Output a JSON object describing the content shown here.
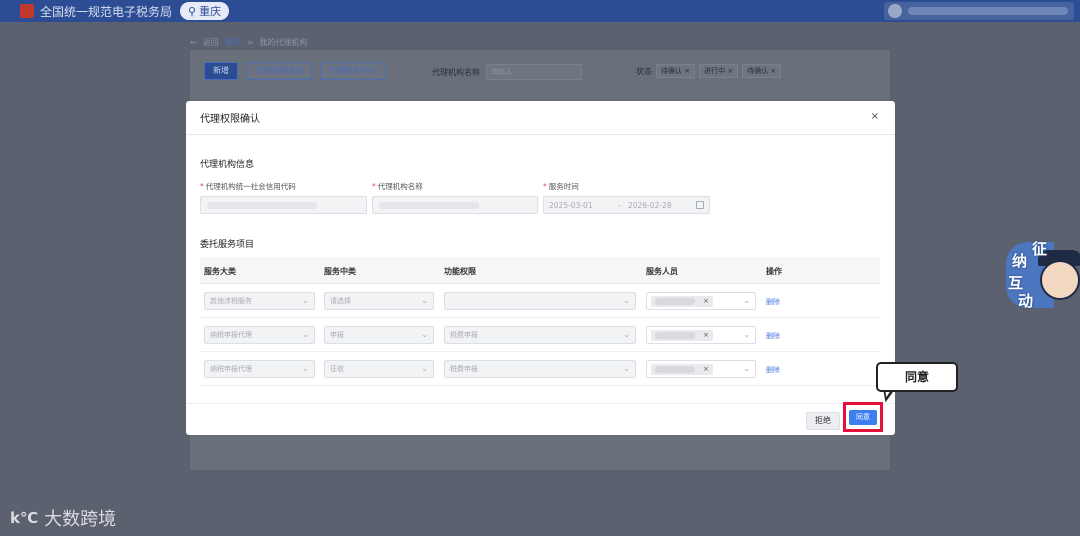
{
  "header": {
    "title": "全国统一规范电子税务局",
    "region": "重庆",
    "region_icon": "location-pin-icon"
  },
  "background_page": {
    "back_label": "返回",
    "breadcrumb_home": "首页",
    "breadcrumb_separator": ">",
    "breadcrumb_current": "我的代理机构",
    "buttons": [
      "新增",
      "代理机构查询",
      "代理机构评价"
    ],
    "filter_label": "代理机构名称",
    "filter_placeholder": "请输入",
    "status_label": "状态",
    "status_tags": [
      "待确认",
      "进行中",
      "待确认"
    ]
  },
  "modal": {
    "title": "代理权限确认",
    "close_glyph": "×",
    "info_section": "代理机构信息",
    "field_credit_code": "代理机构统一社会信用代码",
    "field_name": "代理机构名称",
    "field_service_time": "服务时间",
    "date_start": "2025-03-01",
    "date_separator": "-",
    "date_end": "2026-02-28",
    "service_section": "委托服务项目",
    "columns": [
      "服务大类",
      "服务中类",
      "功能权限",
      "服务人员",
      "操作"
    ],
    "rows": [
      {
        "category": "其他涉税服务",
        "subcategory": "请选择",
        "permission": "",
        "action": "删除"
      },
      {
        "category": "纳税申报代理",
        "subcategory": "申报",
        "permission": "税费申报",
        "action": "删除"
      },
      {
        "category": "纳税申报代理",
        "subcategory": "征收",
        "permission": "税费申报",
        "action": "删除"
      }
    ],
    "reject_label": "拒绝",
    "agree_label": "同意"
  },
  "callout": "同意",
  "mascot": {
    "chars": [
      "征",
      "纳",
      "互",
      "动"
    ]
  },
  "watermark": "大数跨境",
  "watermark_logo": "k℃"
}
